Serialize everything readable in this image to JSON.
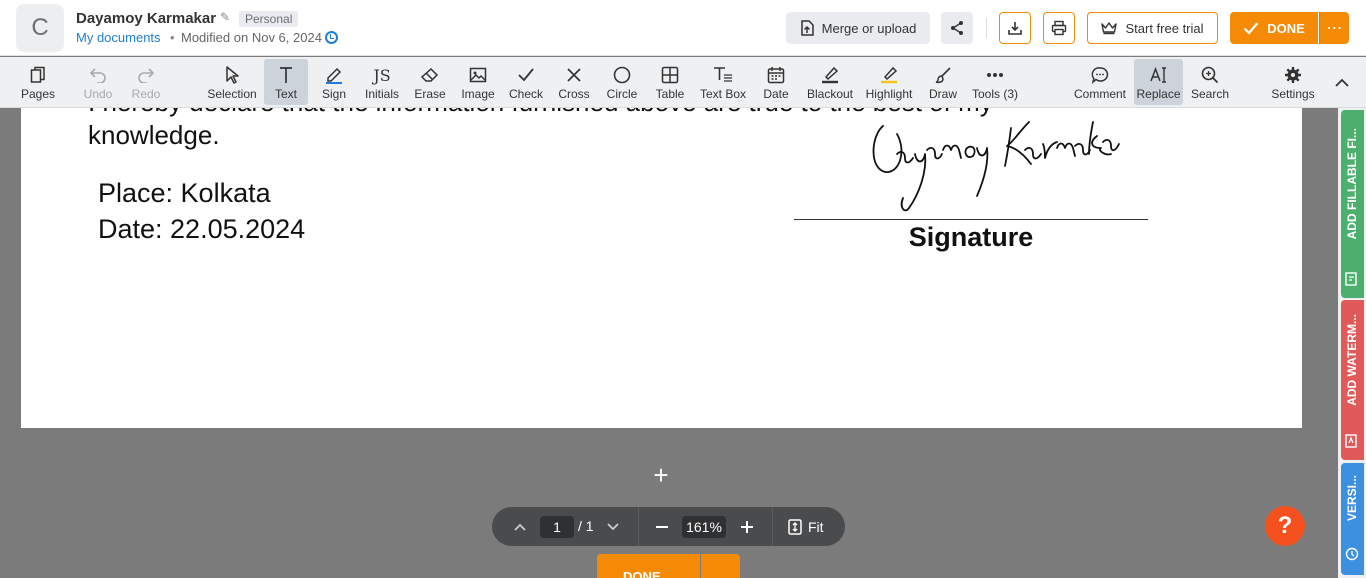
{
  "header": {
    "avatar_letter": "C",
    "doc_name": "Dayamoy Karmakar",
    "badge": "Personal",
    "breadcrumb_link": "My documents",
    "modified": "Modified on Nov 6, 2024",
    "merge_label": "Merge or upload",
    "trial_label": "Start free trial",
    "done_label": "DONE",
    "more_label": "⋯"
  },
  "toolbar": {
    "pages": "Pages",
    "undo": "Undo",
    "redo": "Redo",
    "selection": "Selection",
    "text": "Text",
    "sign": "Sign",
    "initials": "Initials",
    "initials_glyph": "JS",
    "erase": "Erase",
    "image": "Image",
    "check": "Check",
    "cross": "Cross",
    "circle": "Circle",
    "table": "Table",
    "textbox": "Text Box",
    "date": "Date",
    "blackout": "Blackout",
    "highlight": "Highlight",
    "draw": "Draw",
    "tools": "Tools (3)",
    "comment": "Comment",
    "replace": "Replace",
    "search": "Search",
    "settings": "Settings"
  },
  "document": {
    "declaration": "I hereby declare that the information furnished above are true to the best of my",
    "knowledge": "knowledge.",
    "place": "Place: Kolkata",
    "date": "Date:  22.05.2024",
    "signature_label": "Signature"
  },
  "pager": {
    "current_page": "1",
    "total_pages": "/ 1",
    "zoom": "161%",
    "fit_label": "Fit"
  },
  "bottom_done": "DONE",
  "help": "?",
  "side_tabs": {
    "fillable": "ADD FILLABLE FI...",
    "watermark": "ADD WATERM...",
    "version": "VERSI..."
  },
  "colors": {
    "accent": "#f58a07",
    "link": "#1f7ed6",
    "help": "#f4511e",
    "tab_green": "#4caf6e",
    "tab_red": "#e05a5a",
    "tab_blue": "#3d8fe0"
  }
}
